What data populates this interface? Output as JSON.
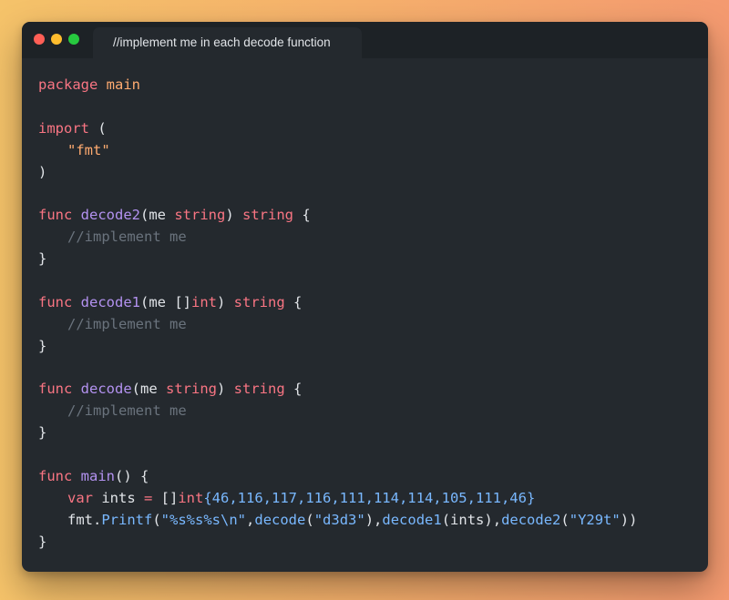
{
  "window": {
    "tab_title": "//implement me in each decode function"
  },
  "code": {
    "l1_kw": "package",
    "l1_name": "main",
    "l3_kw": "import",
    "l3_paren": "(",
    "l4_str": "\"fmt\"",
    "l5_paren": ")",
    "l7_func": "func",
    "l7_name": "decode2",
    "l7_open": "(me ",
    "l7_type": "string",
    "l7_close": ") ",
    "l7_ret": "string",
    "l7_brace": " {",
    "l8_comment": "//implement me",
    "l9_brace": "}",
    "l11_func": "func",
    "l11_name": "decode1",
    "l11_open": "(me []",
    "l11_type": "int",
    "l11_close": ") ",
    "l11_ret": "string",
    "l11_brace": " {",
    "l12_comment": "//implement me",
    "l13_brace": "}",
    "l15_func": "func",
    "l15_name": "decode",
    "l15_open": "(me ",
    "l15_type": "string",
    "l15_close": ") ",
    "l15_ret": "string",
    "l15_brace": " {",
    "l16_comment": "//implement me",
    "l17_brace": "}",
    "l19_func": "func",
    "l19_name": "main",
    "l19_rest": "() {",
    "l20_var": "var",
    "l20_name": " ints ",
    "l20_eq": "=",
    "l20_sp": " []",
    "l20_type": "int",
    "l20_nums": "{46,116,117,116,111,114,114,105,111,46}",
    "l21_pkg": "fmt.",
    "l21_printf": "Printf",
    "l21_open": "(",
    "l21_fmt": "\"%s%s%s",
    "l21_esc": "\\n",
    "l21_fmtend": "\"",
    "l21_comma1": ",",
    "l21_decode": "decode",
    "l21_p1": "(",
    "l21_s1": "\"d3d3\"",
    "l21_p1c": ")",
    "l21_comma2": ",",
    "l21_decode1": "decode1",
    "l21_arg2": "(ints)",
    "l21_comma3": ",",
    "l21_decode2": "decode2",
    "l21_p3": "(",
    "l21_s3": "\"Y29t\"",
    "l21_end": "))",
    "l22_brace": "}"
  }
}
